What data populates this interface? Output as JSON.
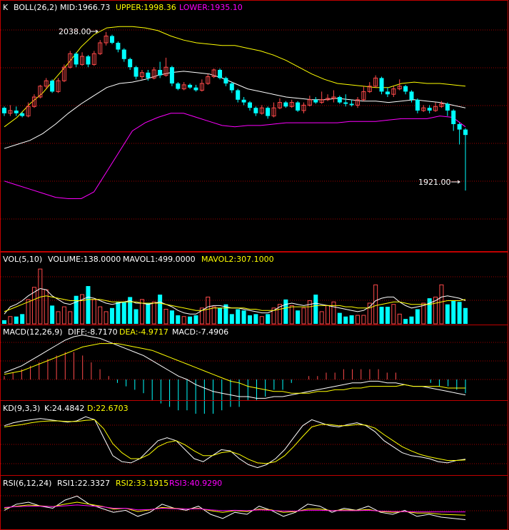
{
  "panels": {
    "kline": {
      "k": "K",
      "title": "BOLL(26,2)",
      "mid": "MID:1966.73",
      "upper": "UPPER:1998.36",
      "lower": "LOWER:1935.10",
      "high_marker": "2038.00",
      "low_marker": "1921.00"
    },
    "vol": {
      "title": "VOL(5,10)",
      "volume": "VOLUME:138.0000",
      "mavol1": "MAVOL1:499.0000",
      "mavol2": "MAVOL2:307.1000"
    },
    "macd": {
      "title": "MACD(12,26,9)",
      "diff": "DIFF:-8.7170",
      "dea": "DEA:-4.9717",
      "macd": "MACD:-7.4906"
    },
    "kd": {
      "title": "KD(9,3,3)",
      "k": "K:24.4842",
      "d": "D:22.6703"
    },
    "rsi": {
      "title": "RSI(6,12,24)",
      "rsi1": "RSI1:22.3327",
      "rsi2": "RSI2:33.1915",
      "rsi3": "RSI3:40.9290"
    }
  },
  "colors": {
    "background": "#000000",
    "frame": "#c00000",
    "grid": "#a00000",
    "up": "#ff4a4a",
    "down": "#00ffff",
    "white_line": "#ffffff",
    "yellow_line": "#ffff00",
    "magenta_line": "#ff00ff",
    "label_text": "#ffffff"
  },
  "chart_data": {
    "type": "candlestick",
    "price_range": [
      1880,
      2050
    ],
    "candles": [
      [
        1982,
        1978,
        1983,
        1976
      ],
      [
        1978,
        1980,
        1984,
        1976
      ],
      [
        1980,
        1978,
        1983,
        1976
      ],
      [
        1978,
        1976,
        1979,
        1975
      ],
      [
        1976,
        1983,
        1986,
        1975
      ],
      [
        1983,
        1990,
        1992,
        1982
      ],
      [
        1990,
        1998,
        1999,
        1989
      ],
      [
        1998,
        2002,
        2004,
        1996
      ],
      [
        2002,
        1994,
        2003,
        1993
      ],
      [
        1994,
        2002,
        2004,
        1993
      ],
      [
        2002,
        2012,
        2014,
        2001
      ],
      [
        2012,
        2022,
        2024,
        2011
      ],
      [
        2022,
        2014,
        2023,
        2012
      ],
      [
        2014,
        2020,
        2023,
        2013
      ],
      [
        2020,
        2014,
        2021,
        2012
      ],
      [
        2014,
        2022,
        2024,
        2013
      ],
      [
        2022,
        2030,
        2032,
        2021
      ],
      [
        2030,
        2035,
        2038,
        2028
      ],
      [
        2035,
        2030,
        2036,
        2029
      ],
      [
        2030,
        2025,
        2031,
        2023
      ],
      [
        2025,
        2018,
        2026,
        2016
      ],
      [
        2018,
        2012,
        2019,
        2010
      ],
      [
        2012,
        2005,
        2013,
        2003
      ],
      [
        2005,
        2008,
        2010,
        2003
      ],
      [
        2008,
        2004,
        2010,
        2002
      ],
      [
        2004,
        2010,
        2012,
        2003
      ],
      [
        2010,
        2006,
        2016,
        2004
      ],
      [
        2006,
        2012,
        2019,
        2005
      ],
      [
        2012,
        2000,
        2013,
        1998
      ],
      [
        2000,
        1996,
        2001,
        1995
      ],
      [
        1996,
        1999,
        2001,
        1995
      ],
      [
        1999,
        1997,
        2000,
        1996
      ],
      [
        1997,
        1995,
        1999,
        1994
      ],
      [
        1995,
        2000,
        2003,
        1994
      ],
      [
        2000,
        2005,
        2007,
        1999
      ],
      [
        2005,
        2010,
        2011,
        2004
      ],
      [
        2010,
        2004,
        2011,
        2003
      ],
      [
        2004,
        2000,
        2005,
        1998
      ],
      [
        2000,
        1995,
        2001,
        1993
      ],
      [
        1995,
        1988,
        1996,
        1986
      ],
      [
        1988,
        1986,
        1990,
        1984
      ],
      [
        1986,
        1982,
        1987,
        1980
      ],
      [
        1982,
        1978,
        1983,
        1976
      ],
      [
        1978,
        1982,
        1984,
        1977
      ],
      [
        1982,
        1976,
        1983,
        1974
      ],
      [
        1976,
        1982,
        1986,
        1975
      ],
      [
        1982,
        1986,
        1989,
        1981
      ],
      [
        1986,
        1983,
        1987,
        1982
      ],
      [
        1983,
        1986,
        1988,
        1982
      ],
      [
        1986,
        1980,
        1987,
        1979
      ],
      [
        1980,
        1984,
        1986,
        1978
      ],
      [
        1984,
        1988,
        1991,
        1983
      ],
      [
        1988,
        1986,
        1990,
        1985
      ],
      [
        1986,
        1988,
        1994,
        1985
      ],
      [
        1988,
        1989,
        1992,
        1987
      ],
      [
        1989,
        1990,
        1995,
        1986
      ],
      [
        1990,
        1986,
        1991,
        1985
      ],
      [
        1986,
        1985,
        1992,
        1983
      ],
      [
        1985,
        1984,
        1988,
        1983
      ],
      [
        1984,
        1988,
        1990,
        1982
      ],
      [
        1988,
        1994,
        1998,
        1987
      ],
      [
        1994,
        1998,
        2001,
        1993
      ],
      [
        1998,
        2004,
        2006,
        1997
      ],
      [
        2004,
        1994,
        2005,
        1992
      ],
      [
        1994,
        1992,
        1997,
        1990
      ],
      [
        1992,
        1996,
        1998,
        1990
      ],
      [
        1996,
        1998,
        2003,
        1995
      ],
      [
        1998,
        1994,
        1999,
        1992
      ],
      [
        1994,
        1988,
        1995,
        1986
      ],
      [
        1988,
        1980,
        1989,
        1978
      ],
      [
        1980,
        1982,
        1984,
        1979
      ],
      [
        1982,
        1980,
        1984,
        1978
      ],
      [
        1980,
        1983,
        1986,
        1979
      ],
      [
        1983,
        1985,
        1987,
        1982
      ],
      [
        1985,
        1980,
        1986,
        1976
      ],
      [
        1980,
        1970,
        1981,
        1965
      ],
      [
        1970,
        1966,
        1971,
        1955
      ],
      [
        1966,
        1962,
        1967,
        1921
      ]
    ],
    "upper_band": [
      1968,
      1975,
      1985,
      1993,
      2004,
      2015,
      2027,
      2036,
      2041,
      2042,
      2042,
      2041,
      2039,
      2035,
      2032,
      2030,
      2029,
      2028,
      2028,
      2026,
      2024,
      2021,
      2017,
      2012,
      2007,
      2003,
      2000,
      1999,
      1998,
      1997,
      1997,
      2000,
      2001,
      2000,
      2000,
      1999,
      1998
    ],
    "mid_band": [
      1952,
      1955,
      1958,
      1963,
      1970,
      1978,
      1985,
      1991,
      1997,
      2000,
      2001,
      2003,
      2006,
      2008,
      2009,
      2008,
      2007,
      2004,
      2000,
      1996,
      1994,
      1992,
      1990,
      1989,
      1988,
      1988,
      1989,
      1988,
      1987,
      1987,
      1986,
      1987,
      1988,
      1987,
      1986,
      1984,
      1982
    ],
    "lower_band": [
      1928,
      1925,
      1922,
      1919,
      1916,
      1915,
      1915,
      1920,
      1935,
      1950,
      1965,
      1971,
      1975,
      1978,
      1978,
      1975,
      1972,
      1969,
      1968,
      1969,
      1969,
      1970,
      1971,
      1971,
      1971,
      1971,
      1971,
      1972,
      1972,
      1972,
      1973,
      1974,
      1974,
      1974,
      1976,
      1975,
      1968
    ],
    "volume": [
      30,
      60,
      60,
      80,
      200,
      300,
      450,
      280,
      150,
      100,
      140,
      100,
      230,
      240,
      310,
      200,
      140,
      100,
      130,
      180,
      180,
      220,
      120,
      200,
      170,
      180,
      240,
      120,
      110,
      70,
      60,
      60,
      70,
      130,
      220,
      140,
      130,
      160,
      80,
      120,
      110,
      70,
      80,
      60,
      80,
      130,
      160,
      200,
      150,
      110,
      130,
      190,
      240,
      100,
      150,
      180,
      90,
      60,
      70,
      70,
      70,
      170,
      320,
      140,
      140,
      160,
      80,
      40,
      60,
      120,
      170,
      210,
      220,
      320,
      160,
      190,
      180,
      130
    ],
    "vol_ma1": [
      80,
      140,
      160,
      190,
      230,
      260,
      290,
      280,
      230,
      200,
      170,
      160,
      180,
      200,
      220,
      210,
      190,
      170,
      160,
      170,
      180,
      190,
      170,
      170,
      160,
      170,
      180,
      160,
      140,
      110,
      90,
      80,
      80,
      110,
      140,
      150,
      150,
      140,
      130,
      130,
      120,
      110,
      100,
      90,
      90,
      110,
      140,
      160,
      170,
      160,
      150,
      160,
      170,
      160,
      150,
      140,
      130,
      120,
      110,
      100,
      110,
      140,
      190,
      210,
      220,
      220,
      180,
      150,
      130,
      140,
      150,
      170,
      190,
      220,
      230,
      220,
      210,
      190
    ],
    "vol_ma2": [
      100,
      120,
      140,
      160,
      180,
      200,
      220,
      230,
      220,
      210,
      200,
      190,
      190,
      190,
      200,
      200,
      200,
      190,
      180,
      180,
      180,
      180,
      180,
      170,
      170,
      170,
      170,
      160,
      150,
      140,
      130,
      120,
      110,
      110,
      120,
      130,
      130,
      130,
      130,
      130,
      130,
      120,
      120,
      110,
      110,
      110,
      120,
      130,
      140,
      140,
      140,
      140,
      150,
      150,
      150,
      150,
      150,
      140,
      140,
      130,
      130,
      130,
      150,
      160,
      170,
      180,
      180,
      170,
      160,
      160,
      160,
      160,
      170,
      180,
      190,
      190,
      190,
      200
    ],
    "macd_diff": [
      4,
      6,
      8,
      11,
      14,
      17,
      20,
      23,
      25,
      26,
      25,
      24,
      22,
      20,
      18,
      16,
      14,
      11,
      8,
      5,
      2,
      0,
      -3,
      -5,
      -7,
      -8,
      -9,
      -10,
      -10,
      -11,
      -11,
      -10,
      -10,
      -9,
      -8,
      -7,
      -6,
      -5,
      -4,
      -3,
      -2,
      -2,
      -1,
      -1,
      -2,
      -2,
      -3,
      -4,
      -4,
      -5,
      -6,
      -7,
      -8,
      -9
    ],
    "macd_dea": [
      3,
      4,
      5,
      7,
      9,
      11,
      13,
      15,
      17,
      19,
      20,
      21,
      21,
      21,
      20,
      19,
      18,
      17,
      15,
      13,
      11,
      9,
      7,
      5,
      3,
      1,
      -1,
      -2,
      -4,
      -5,
      -6,
      -7,
      -7,
      -8,
      -8,
      -8,
      -7,
      -7,
      -6,
      -6,
      -5,
      -5,
      -4,
      -4,
      -4,
      -4,
      -3,
      -4,
      -4,
      -4,
      -4,
      -5,
      -5,
      -5
    ],
    "kd_k": [
      80,
      85,
      88,
      90,
      92,
      90,
      88,
      86,
      88,
      95,
      90,
      60,
      30,
      20,
      18,
      25,
      40,
      55,
      60,
      55,
      40,
      25,
      20,
      30,
      40,
      38,
      25,
      15,
      10,
      15,
      25,
      40,
      60,
      80,
      90,
      85,
      80,
      78,
      82,
      85,
      80,
      70,
      55,
      45,
      35,
      30,
      28,
      25,
      20,
      18,
      22,
      24
    ],
    "kd_d": [
      78,
      80,
      82,
      85,
      87,
      88,
      88,
      87,
      87,
      89,
      90,
      75,
      50,
      35,
      25,
      25,
      32,
      45,
      52,
      55,
      48,
      38,
      30,
      30,
      35,
      37,
      32,
      24,
      18,
      17,
      20,
      30,
      45,
      62,
      78,
      82,
      82,
      80,
      80,
      82,
      81,
      76,
      65,
      55,
      45,
      38,
      32,
      28,
      25,
      22,
      22,
      23
    ],
    "rsi1": [
      45,
      60,
      65,
      55,
      50,
      70,
      80,
      60,
      50,
      40,
      45,
      30,
      40,
      60,
      50,
      45,
      55,
      35,
      25,
      40,
      35,
      55,
      45,
      30,
      40,
      60,
      55,
      40,
      50,
      45,
      55,
      40,
      35,
      45,
      30,
      35,
      28,
      25,
      22
    ],
    "rsi2": [
      50,
      55,
      58,
      56,
      54,
      60,
      65,
      60,
      55,
      48,
      50,
      42,
      46,
      52,
      50,
      48,
      50,
      44,
      40,
      44,
      42,
      48,
      46,
      40,
      42,
      48,
      48,
      44,
      46,
      45,
      47,
      42,
      40,
      42,
      38,
      38,
      35,
      34,
      33
    ],
    "rsi3": [
      52,
      54,
      55,
      55,
      54,
      56,
      58,
      56,
      54,
      50,
      50,
      46,
      47,
      50,
      49,
      48,
      49,
      46,
      44,
      45,
      44,
      46,
      45,
      43,
      43,
      45,
      45,
      44,
      44,
      44,
      45,
      43,
      42,
      42,
      41,
      41,
      41,
      41,
      41
    ]
  }
}
